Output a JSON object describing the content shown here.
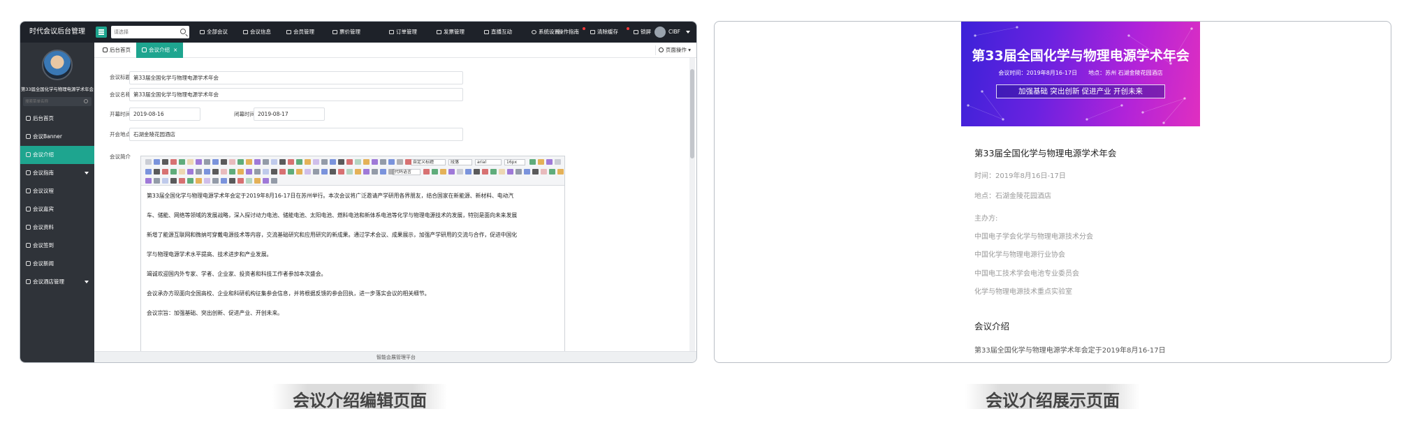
{
  "editor_panel": {
    "app_title": "时代会议后台管理",
    "search_placeholder": "请选择",
    "nav": [
      "全部会议",
      "会议信息",
      "会员管理",
      "票价管理",
      "订单管理",
      "发票管理",
      "直播互动",
      "系统设置",
      "操作指南",
      "清除缓存",
      "锁屏"
    ],
    "user_name": "CIBF",
    "sidebar": {
      "org_title": "第33届全国化学与物理电源学术年会",
      "search_placeholder": "搜索菜单名称",
      "items": [
        "后台首页",
        "会议Banner",
        "会议介绍",
        "会议指南",
        "会议议程",
        "会议嘉宾",
        "会议资料",
        "会议签到",
        "会议新闻",
        "会议酒店管理"
      ]
    },
    "tabs": {
      "home": "后台首页",
      "current": "会议介绍",
      "close": "×",
      "page_ops": "页面操作"
    },
    "form": {
      "title_label": "会议标题",
      "title_value": "第33届全国化学与物理电源学术年会",
      "name_label": "会议名称",
      "name_value": "第33届全国化学与物理电源学术年会",
      "open_label": "开幕时间",
      "open_value": "2019-08-16",
      "close_label": "闭幕时间",
      "close_value": "2019-08-17",
      "venue_label": "开会地点",
      "venue_value": "石湖金陵花园酒店",
      "intro_label": "会议简介",
      "required_mark": "*"
    },
    "toolbar_selects": {
      "custom_title": "自定义标题",
      "paragraph": "段落",
      "font": "arial",
      "size": "16px",
      "code_lang": "代码语言"
    },
    "editor_paragraphs": [
      "第33届全国化学与物理电源学术年会定于2019年8月16-17日在苏州举行。本次会议将广泛邀请产学研用各界朋友，结合国家在新能源、新材料、电动汽",
      "车、储能、网络等领域的发展战略，深入探讨动力电池、储能电池、太阳电池、燃料电池和新体系电池等化学与物理电源技术的发展，特别是面向未来发展",
      "新增了能源互联网和微纳可穿戴电源技术等内容，交流基础研究和应用研究的新成果。通过学术会议、成果展示，加强产学研用的交流与合作，促进中国化",
      "学与物理电源学术水平提高、技术进步和产业发展。",
      "竭诚欢迎国内外专家、学者、企业家、投资者和科技工作者参加本次盛会。",
      "会议承办方现面向全国高校、企业和科研机构征集参会信息，并将根据反馈的参会回执，进一步落实会议的相关细节。",
      "会议宗旨：加强基础、突出创新、促进产业、开创未来。"
    ],
    "footer": "智能会展管理平台",
    "accent_color": "#1ea58f"
  },
  "display_panel": {
    "banner": {
      "title": "第33届全国化学与物理电源学术年会",
      "subtitle": "会议时间：2019年8月16-17日　　地点：苏州 石湖金陵花园酒店",
      "slogan": "加强基础  突出创新  促进产业  开创未来"
    },
    "title": "第33届全国化学与物理电源学术年会",
    "time": "时间：2019年8月16日-17日",
    "location": "地点：石湖金陵花园酒店",
    "organizers_label": "主办方:",
    "organizers": [
      "中国电子学会化学与物理电源技术分会",
      "中国化学与物理电源行业协会",
      "中国电工技术学会电池专业委员会",
      "化学与物理电源技术重点实验室"
    ],
    "intro_heading": "会议介绍",
    "intro_snippet": "第33届全国化学与物理电源学术年会定于2019年8月16-17日"
  },
  "captions": {
    "left": "会议介绍编辑页面",
    "right": "会议介绍展示页面"
  }
}
